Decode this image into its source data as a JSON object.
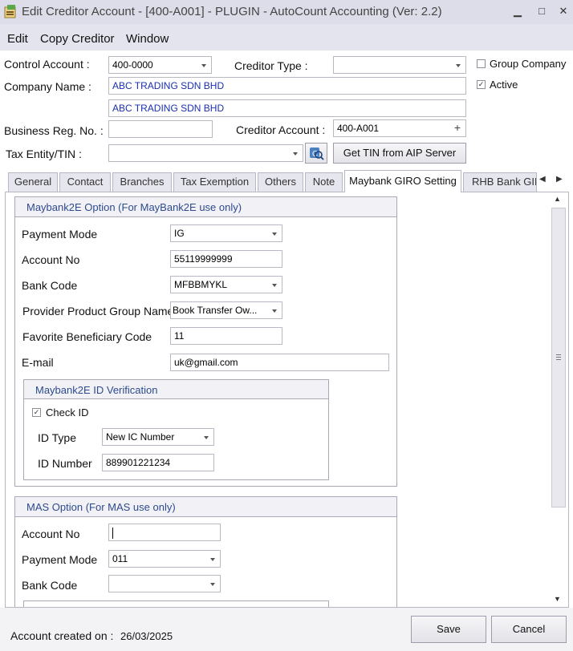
{
  "window": {
    "title": "Edit Creditor Account - [400-A001] - PLUGIN - AutoCount Accounting (Ver: 2.2)",
    "minimize": "▁",
    "maximize": "□",
    "close": "✕"
  },
  "menu": [
    "Edit",
    "Copy Creditor",
    "Window"
  ],
  "header": {
    "control_account_label": "Control Account :",
    "control_account_value": "400-0000",
    "creditor_type_label": "Creditor Type :",
    "creditor_type_value": "",
    "group_company_label": "Group Company",
    "group_company_checked": false,
    "active_label": "Active",
    "active_checked": true,
    "company_name_label": "Company Name :",
    "company_name_1": "ABC TRADING SDN BHD",
    "company_name_2": "ABC TRADING SDN BHD",
    "business_reg_label": "Business Reg. No. :",
    "business_reg_value": "",
    "creditor_account_label": "Creditor Account :",
    "creditor_account_value": "400-A001",
    "tax_entity_label": "Tax Entity/TIN  :",
    "tax_entity_value": "",
    "get_tin_button": "Get TIN from AIP Server"
  },
  "tabs": [
    "General",
    "Contact",
    "Branches",
    "Tax Exemption",
    "Others",
    "Note",
    "Maybank GIRO Setting",
    "RHB Bank GIRO"
  ],
  "active_tab": "Maybank GIRO Setting",
  "maybank": {
    "title": "Maybank2E Option (For MayBank2E use only)",
    "payment_mode_label": "Payment Mode",
    "payment_mode_value": "IG",
    "account_no_label": "Account No",
    "account_no_value": "55119999999",
    "bank_code_label": "Bank Code",
    "bank_code_value": "MFBBMYKL",
    "provider_label": "Provider Product Group Name",
    "provider_value": "Book Transfer Ow...",
    "fav_label": "Favorite Beneficiary Code",
    "fav_value": "11",
    "email_label": "E-mail",
    "email_value": "uk@gmail.com",
    "verification": {
      "title": "Maybank2E ID Verification",
      "check_id_label": "Check ID",
      "check_id_checked": true,
      "id_type_label": "ID Type",
      "id_type_value": "New IC Number",
      "id_number_label": "ID Number",
      "id_number_value": "889901221234"
    }
  },
  "mas": {
    "title": "MAS Option (For MAS use only)",
    "account_no_label": "Account No",
    "account_no_value": "",
    "payment_mode_label": "Payment Mode",
    "payment_mode_value": "011",
    "bank_code_label": "Bank Code",
    "bank_code_value": ""
  },
  "footer": {
    "created_label": "Account created on :",
    "created_value": "26/03/2025",
    "save": "Save",
    "cancel": "Cancel"
  }
}
